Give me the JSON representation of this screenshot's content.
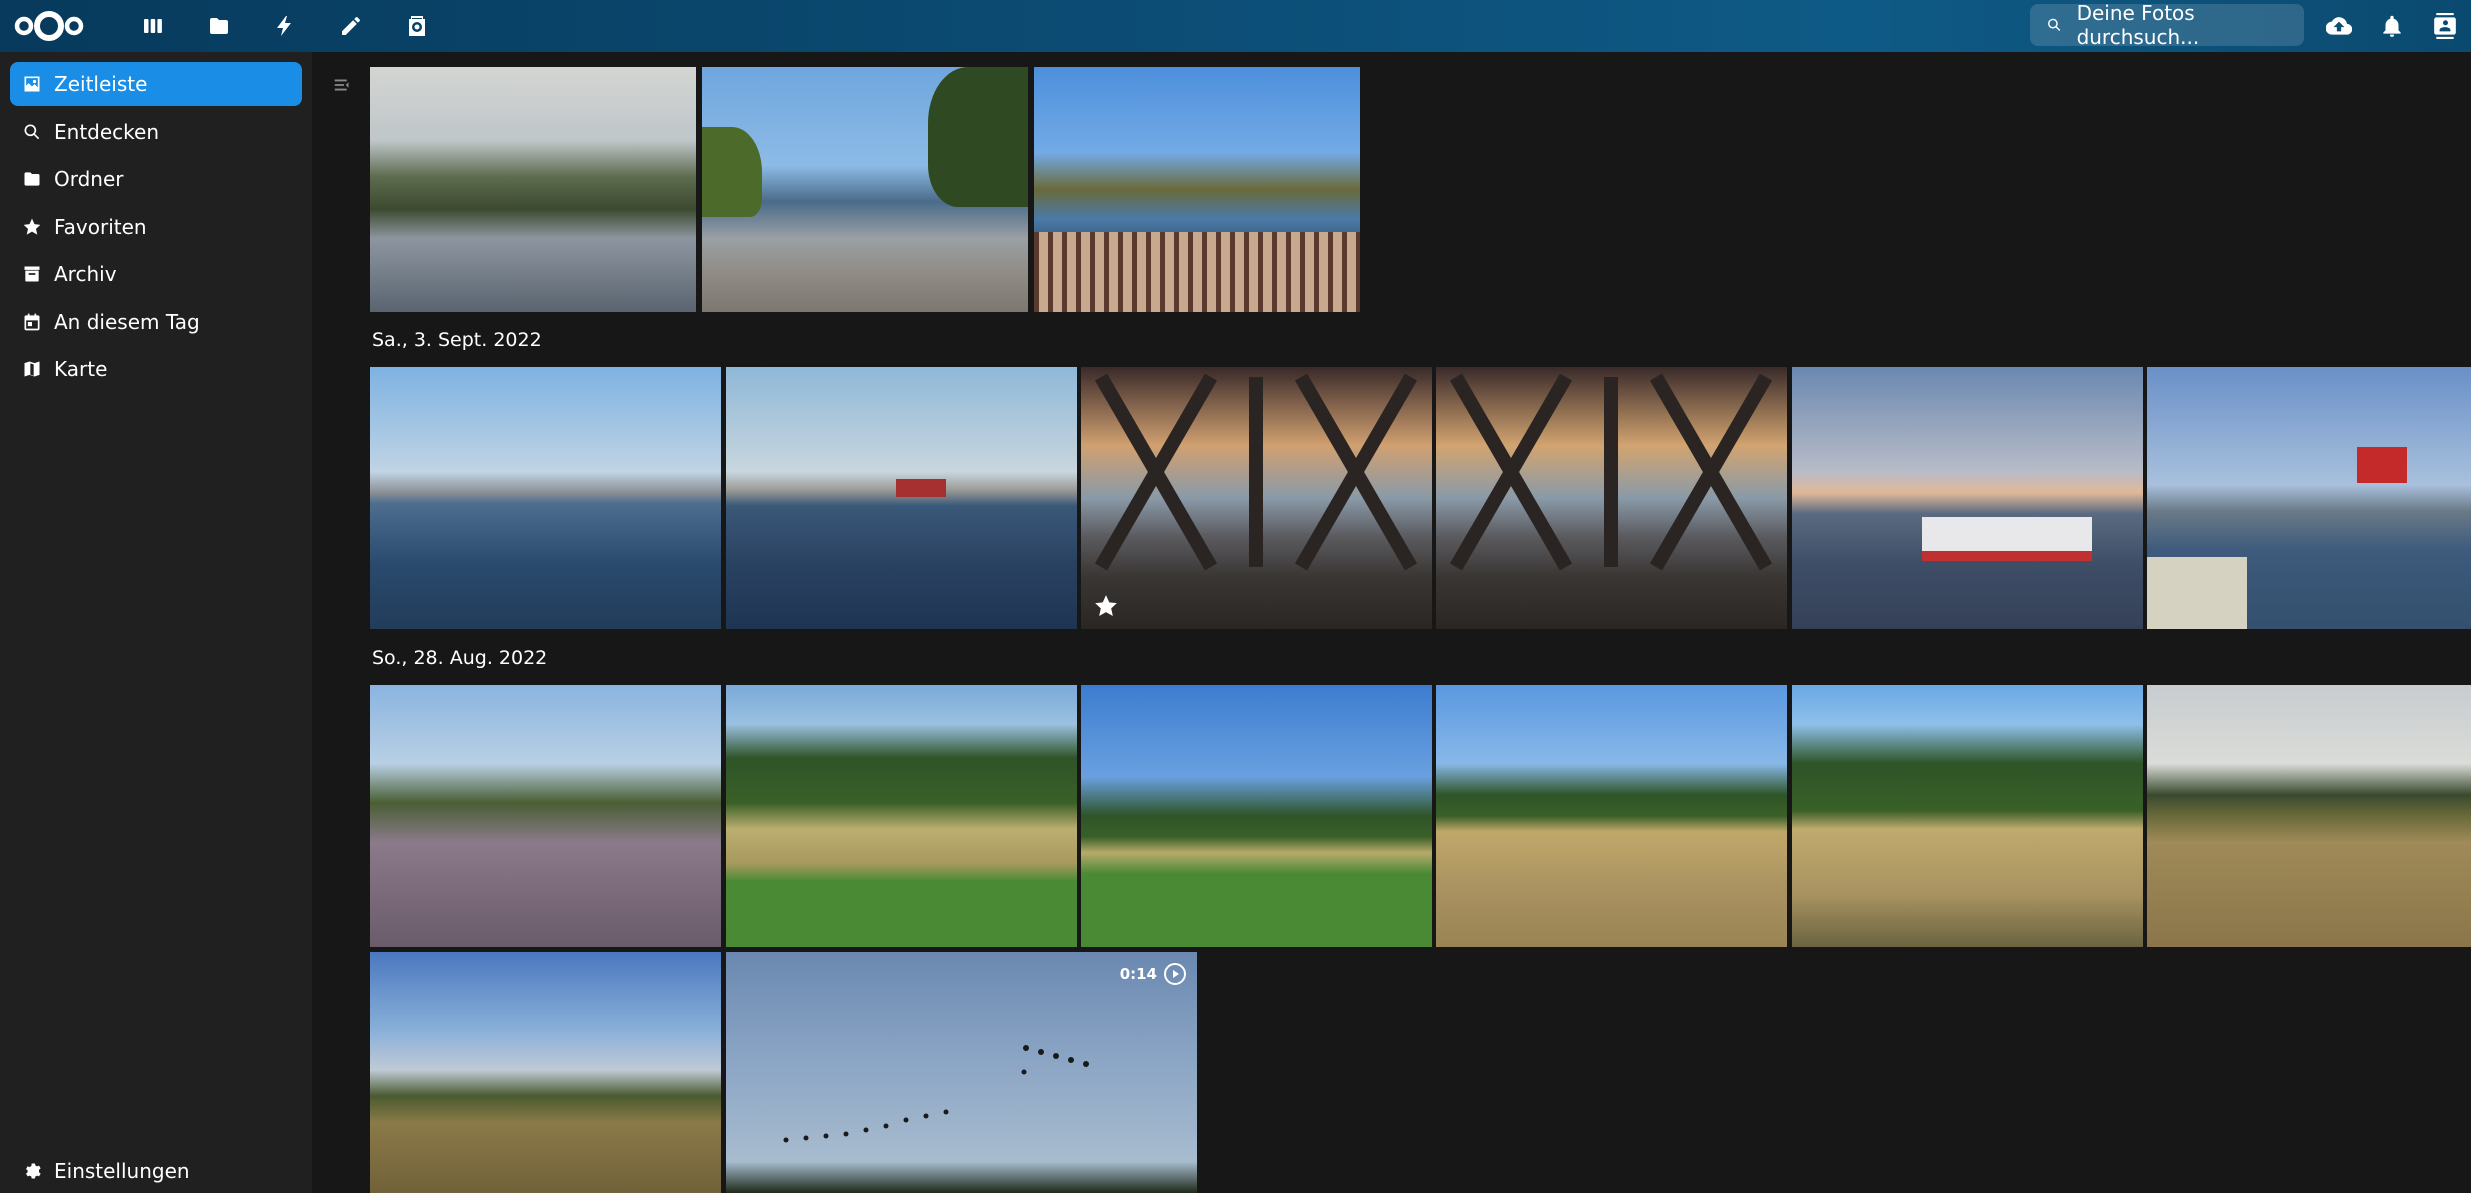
{
  "header": {
    "apps": [
      {
        "name": "dashboard",
        "icon": "dashboard-icon"
      },
      {
        "name": "files",
        "icon": "folder-icon"
      },
      {
        "name": "activity",
        "icon": "lightning-icon"
      },
      {
        "name": "notes",
        "icon": "pencil-icon"
      },
      {
        "name": "photos",
        "icon": "camera-icon"
      }
    ],
    "search_placeholder": "Deine Fotos durchsuch...",
    "accent": "#1a8ee6"
  },
  "sidebar": {
    "items": [
      {
        "label": "Zeitleiste",
        "icon": "image-icon",
        "active": true
      },
      {
        "label": "Entdecken",
        "icon": "search-icon",
        "active": false
      },
      {
        "label": "Ordner",
        "icon": "folder-icon",
        "active": false
      },
      {
        "label": "Favoriten",
        "icon": "star-icon",
        "active": false
      },
      {
        "label": "Archiv",
        "icon": "archive-icon",
        "active": false
      },
      {
        "label": "An diesem Tag",
        "icon": "calendar-icon",
        "active": false
      },
      {
        "label": "Karte",
        "icon": "map-icon",
        "active": false
      }
    ],
    "settings_label": "Einstellungen"
  },
  "timeline": {
    "days": [
      {
        "label": ""
      },
      {
        "label": "Sa., 3. Sept. 2022"
      },
      {
        "label": "So., 28. Aug. 2022"
      }
    ],
    "video_duration": "0:14"
  }
}
